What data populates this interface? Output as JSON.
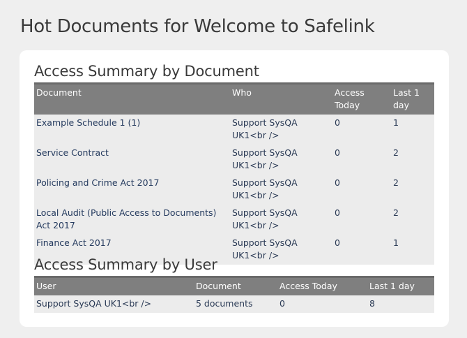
{
  "page_title": "Hot Documents for Welcome to Safelink",
  "by_document": {
    "title": "Access Summary by Document",
    "headers": [
      "Document",
      "Who",
      "Access Today",
      "Last 1 day"
    ],
    "rows": [
      {
        "document": "Example Schedule 1 (1)",
        "who": "Support SysQA UK1<br />",
        "today": "0",
        "last_day": "1"
      },
      {
        "document": "Service Contract",
        "who": "Support SysQA UK1<br />",
        "today": "0",
        "last_day": "2"
      },
      {
        "document": "Policing and Crime Act 2017",
        "who": "Support SysQA UK1<br />",
        "today": "0",
        "last_day": "2"
      },
      {
        "document": "Local Audit (Public Access to Documents) Act 2017",
        "who": "Support SysQA UK1<br />",
        "today": "0",
        "last_day": "2"
      },
      {
        "document": "Finance Act 2017",
        "who": "Support SysQA UK1<br />",
        "today": "0",
        "last_day": "1"
      }
    ]
  },
  "by_user": {
    "title": "Access Summary by User",
    "headers": [
      "User",
      "Document",
      "Access Today",
      "Last 1 day"
    ],
    "rows": [
      {
        "user": "Support SysQA UK1<br />",
        "documents": "5 documents",
        "today": "0",
        "last_day": "8"
      }
    ]
  }
}
